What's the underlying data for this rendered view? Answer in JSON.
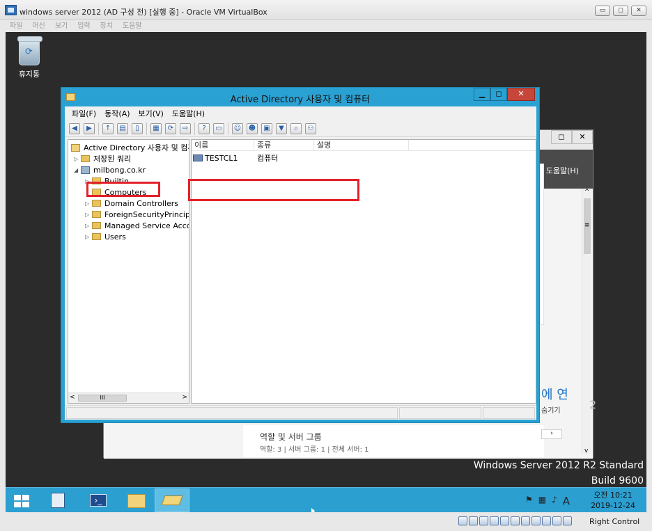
{
  "vbox": {
    "title": "windows server 2012 (AD 구성 전) [실행 중] - Oracle VM VirtualBox",
    "menu": [
      "파일",
      "머신",
      "보기",
      "입력",
      "장치",
      "도움말"
    ],
    "controls": [
      "▭",
      "◻",
      "✕"
    ],
    "host_key": "Right Control"
  },
  "desktop": {
    "recycle_bin": "휴지통",
    "os_name": "Windows Server 2012 R2 Standard",
    "build": "Build 9600"
  },
  "server_manager": {
    "help_menu": "도움말(H)",
    "link_fragment": "에 연",
    "link_sub": "숨기기",
    "roles_title": "역할 및 서버 그룹",
    "roles_summary": "역할: 3  |  서버 그룹: 1  |  전체 서버: 1",
    "scroll_grip": "≡",
    "scroll_right": "›",
    "scroll_up": "^",
    "scroll_down": "v",
    "right_edge_glyph": "2"
  },
  "aduc": {
    "title": "Active Directory 사용자 및 컴퓨터",
    "menu": {
      "file": "파일(F)",
      "action": "동작(A)",
      "view": "보기(V)",
      "help": "도움말(H)"
    },
    "tree": {
      "root": "Active Directory 사용자 및 컴퓨터",
      "saved_queries": "저장된 쿼리",
      "domain": "milbong.co.kr",
      "items": {
        "builtin": "Builtin",
        "computers": "Computers",
        "domain_controllers": "Domain Controllers",
        "foreign": "ForeignSecurityPrincipals",
        "msa": "Managed Service Accounts",
        "users": "Users"
      }
    },
    "columns": {
      "name": "이름",
      "type": "종류",
      "description": "설명"
    },
    "rows": [
      {
        "name": "TESTCL1",
        "type": "컴퓨터"
      }
    ],
    "scroll_left": "<",
    "scroll_right": ">",
    "scroll_grip": "III"
  },
  "taskbar": {
    "time": "오전 10:21",
    "date": "2019-12-24",
    "ime": "A"
  },
  "colors": {
    "highlight_box": "#e32028",
    "aduc_frame": "#2aa1d3",
    "taskbar": "#2c9fd1",
    "close_button": "#c7463a"
  }
}
